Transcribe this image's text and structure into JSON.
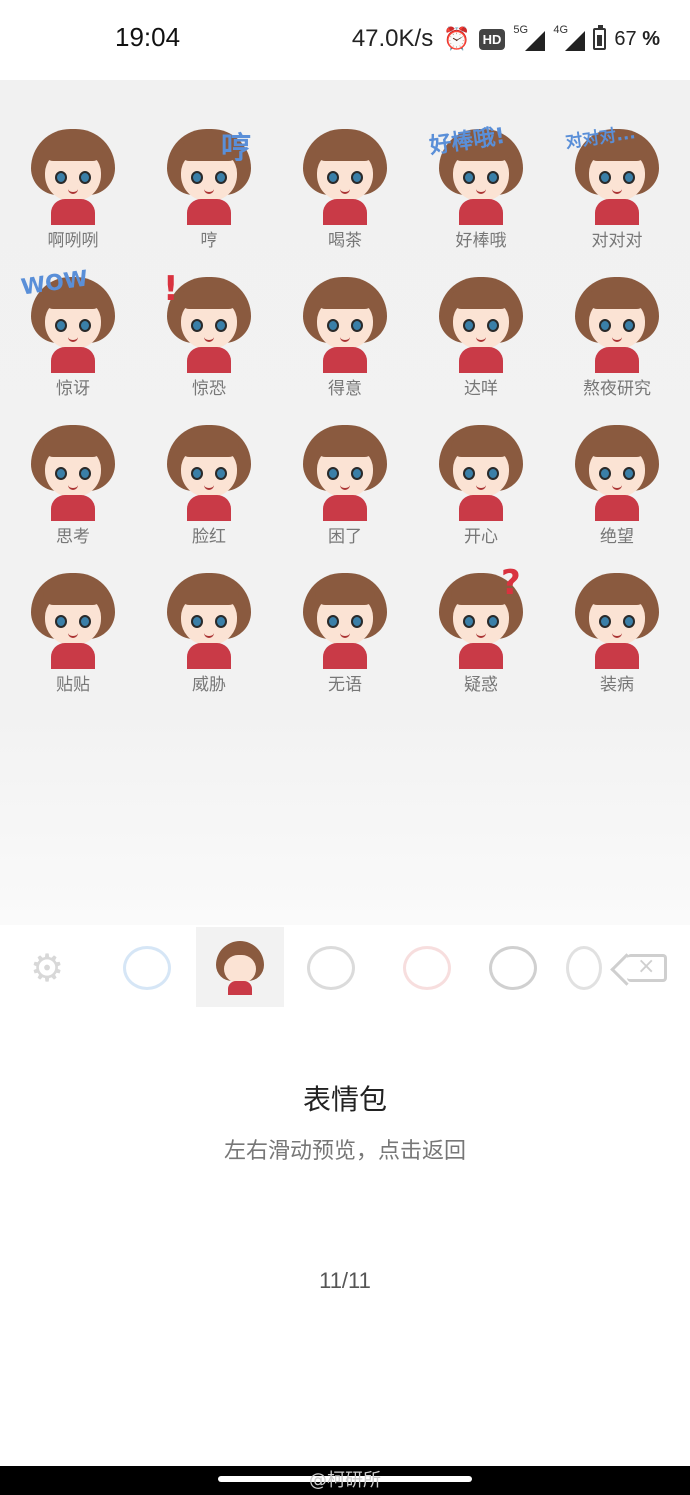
{
  "status_bar": {
    "time": "19:04",
    "net_speed": "47.0K/s",
    "alarm_icon": "alarm-clock-icon",
    "hd_badge": "HD",
    "signal_1": "5G",
    "signal_2": "4G",
    "battery_percent": "67",
    "percent_sign": "%"
  },
  "stickers": [
    {
      "label": "啊咧咧"
    },
    {
      "label": "哼",
      "overlay": "哼"
    },
    {
      "label": "喝茶"
    },
    {
      "label": "好棒哦",
      "overlay": "好棒哦!"
    },
    {
      "label": "对对对",
      "overlay": "对对对..."
    },
    {
      "label": "惊讶",
      "overlay": "WOW"
    },
    {
      "label": "惊恐",
      "overlay": "!"
    },
    {
      "label": "得意"
    },
    {
      "label": "达咩"
    },
    {
      "label": "熬夜研究"
    },
    {
      "label": "思考"
    },
    {
      "label": "脸红"
    },
    {
      "label": "困了"
    },
    {
      "label": "开心"
    },
    {
      "label": "绝望"
    },
    {
      "label": "贴贴"
    },
    {
      "label": "威胁"
    },
    {
      "label": "无语"
    },
    {
      "label": "疑惑",
      "overlay": "?"
    },
    {
      "label": "装病"
    }
  ],
  "tab_bar": {
    "settings_icon": "gear-icon",
    "delete_icon": "backspace-icon"
  },
  "preview": {
    "title": "表情包",
    "hint": "左右滑动预览，点击返回",
    "page": "11/11"
  },
  "watermark": "@柯研所",
  "colors": {
    "hair": "#8a5a3f",
    "sweater": "#c93a47",
    "accent_text": "#5a8fd8"
  }
}
